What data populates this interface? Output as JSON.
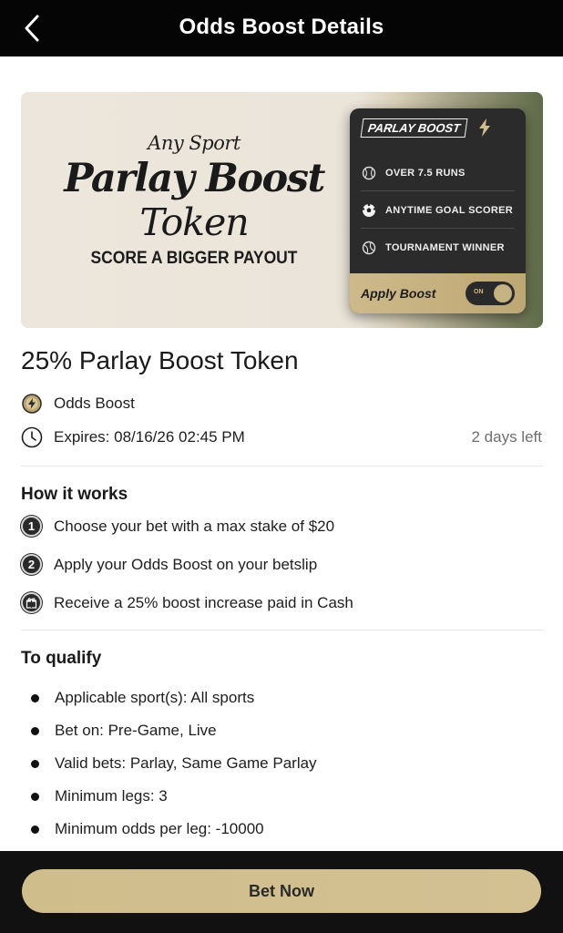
{
  "header": {
    "title": "Odds Boost Details",
    "back_icon": "chevron-left-icon"
  },
  "banner": {
    "left": {
      "line1": "Any Sport",
      "line2": "Parlay Boost",
      "line3": "Token",
      "line4": "SCORE A BIGGER PAYOUT"
    },
    "card": {
      "header_label": "PARLAY BOOST",
      "header_icon": "lightning-bolt-icon",
      "items": [
        {
          "label": "OVER 7.5 RUNS",
          "icon": "baseball-icon"
        },
        {
          "label": "ANYTIME GOAL SCORER",
          "icon": "soccer-ball-icon"
        },
        {
          "label": "TOURNAMENT WINNER",
          "icon": "tennis-ball-icon"
        }
      ],
      "apply_label": "Apply Boost",
      "toggle_label": "ON",
      "toggle_on": true
    }
  },
  "token": {
    "title": "25% Parlay Boost Token",
    "type_label": "Odds Boost",
    "type_icon": "lightning-coin-icon",
    "expires": "Expires: 08/16/26 02:45 PM",
    "expires_icon": "clock-icon",
    "days_left": "2 days left"
  },
  "how_it_works": {
    "title": "How it works",
    "steps": [
      {
        "marker": "1",
        "text": "Choose your bet with a max stake of $20"
      },
      {
        "marker": "2",
        "text": "Apply your Odds Boost on your betslip"
      },
      {
        "marker": "gift-icon",
        "text": "Receive a 25% boost increase paid in Cash"
      }
    ]
  },
  "qualify": {
    "title": "To qualify",
    "items": [
      "Applicable sport(s): All sports",
      "Bet on: Pre-Game, Live",
      "Valid bets: Parlay, Same Game Parlay",
      "Minimum legs: 3",
      "Minimum odds per leg: -10000"
    ]
  },
  "footer": {
    "cta_label": "Bet Now"
  },
  "colors": {
    "gold": "#cfbd8c",
    "black": "#050505",
    "muted": "#6f6f6f"
  }
}
